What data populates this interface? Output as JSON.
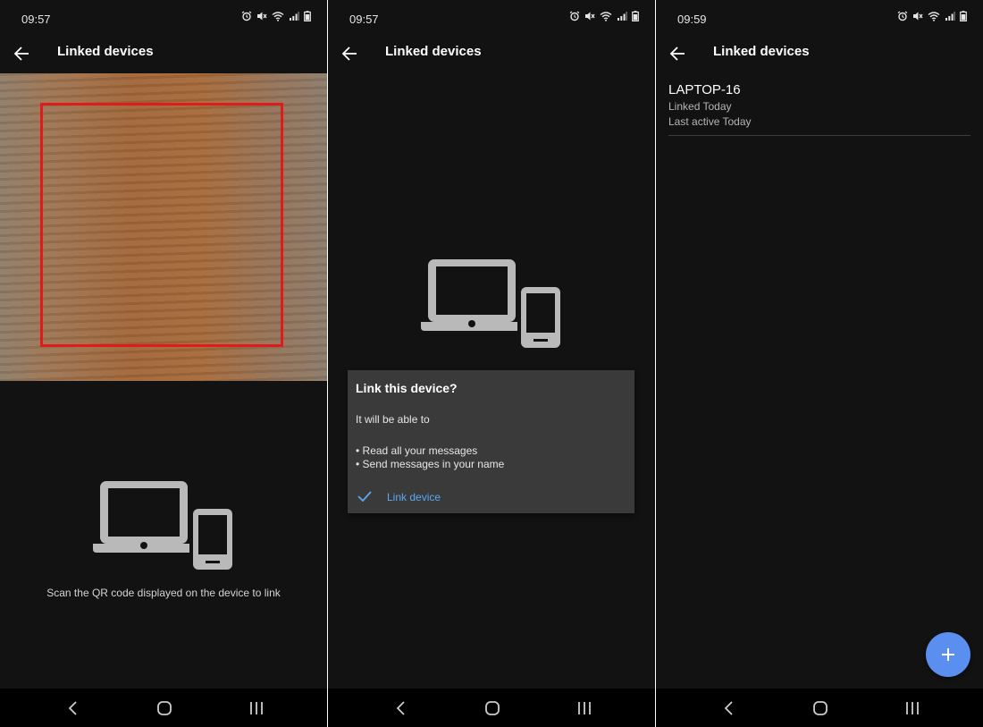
{
  "status_bar": {
    "screen1_time": "09:57",
    "screen2_time": "09:57",
    "screen3_time": "09:59"
  },
  "app_bar": {
    "title": "Linked devices"
  },
  "scan_screen": {
    "hint": "Scan the QR code displayed on the device to link"
  },
  "link_dialog": {
    "title": "Link this device?",
    "intro": "It will be able to",
    "permissions": [
      "• Read all your messages",
      "• Send messages in your name"
    ],
    "action_label": "Link device"
  },
  "device_list": {
    "devices": [
      {
        "name": "LAPTOP-16",
        "linked": "Linked Today",
        "last_active": "Last active Today"
      }
    ]
  },
  "colors": {
    "background": "#121212",
    "scan_frame": "#e01b1b",
    "accent": "#5aa9f0",
    "fab": "#5a8ff0",
    "dialog": "#3a3a3a",
    "nav_bar": "#000000"
  },
  "icons": [
    "arrow-left-icon",
    "alarm-icon",
    "mute-icon",
    "wifi-icon",
    "signal-icon",
    "battery-icon",
    "devices-icon",
    "check-icon",
    "plus-icon",
    "nav-back-icon",
    "nav-home-icon",
    "nav-recents-icon"
  ]
}
